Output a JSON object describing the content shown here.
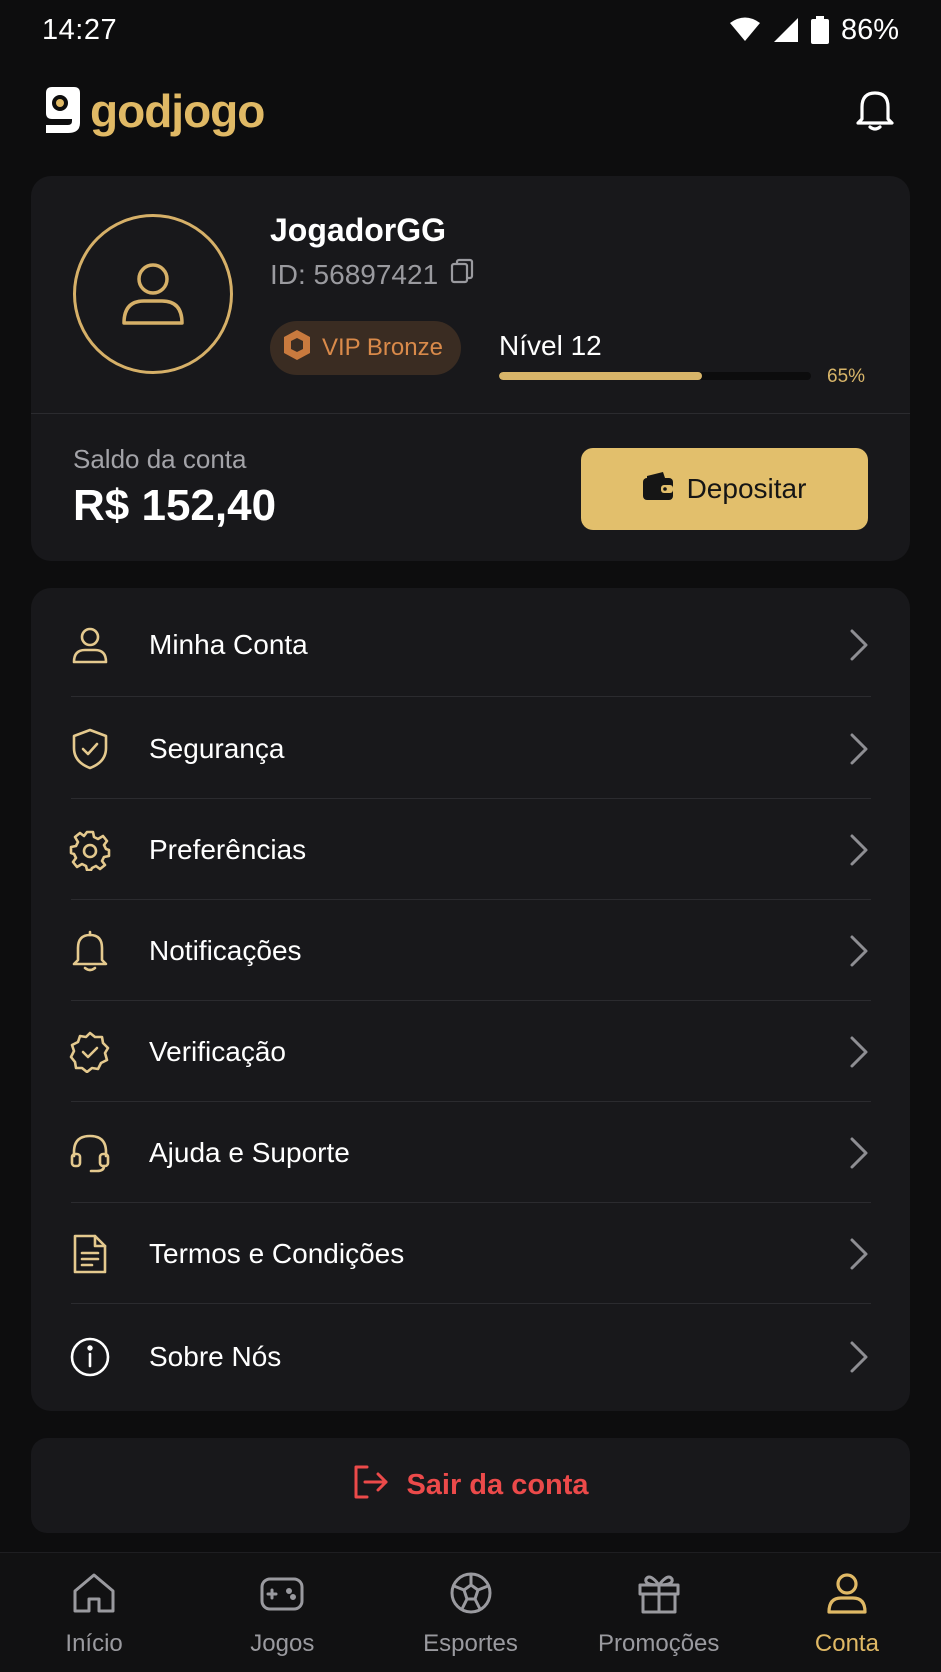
{
  "status_bar": {
    "time": "14:27",
    "battery": "86%"
  },
  "header": {
    "logo_text": "godjogo"
  },
  "profile": {
    "username": "JogadorGG",
    "user_id": "ID: 56897421",
    "vip_label": "VIP Bronze",
    "level_label": "Nível 12",
    "level_progress_pct": 65,
    "level_progress_text": "65%"
  },
  "balance": {
    "label": "Saldo da conta",
    "value": "R$ 152,40",
    "deposit_label": "Depositar"
  },
  "menu": {
    "items": [
      {
        "label": "Minha Conta",
        "icon": "user-icon"
      },
      {
        "label": "Segurança",
        "icon": "shield-check-icon"
      },
      {
        "label": "Preferências",
        "icon": "gear-icon"
      },
      {
        "label": "Notificações",
        "icon": "bell-icon"
      },
      {
        "label": "Verificação",
        "icon": "badge-check-icon"
      },
      {
        "label": "Ajuda e Suporte",
        "icon": "headset-icon"
      },
      {
        "label": "Termos e Condições",
        "icon": "document-icon"
      },
      {
        "label": "Sobre Nós",
        "icon": "info-icon"
      }
    ]
  },
  "logout": {
    "label": "Sair da conta"
  },
  "bottom_nav": {
    "items": [
      {
        "label": "Início",
        "icon": "home-icon"
      },
      {
        "label": "Jogos",
        "icon": "gamepad-icon"
      },
      {
        "label": "Esportes",
        "icon": "soccer-ball-icon"
      },
      {
        "label": "Promoções",
        "icon": "gift-icon"
      },
      {
        "label": "Conta",
        "icon": "user-icon"
      }
    ],
    "active": "Conta"
  },
  "colors": {
    "accent": "#e0b965",
    "background": "#0d0d0e",
    "card": "#18181b",
    "danger": "#ec4a4a",
    "vip": "#d98a4a"
  }
}
